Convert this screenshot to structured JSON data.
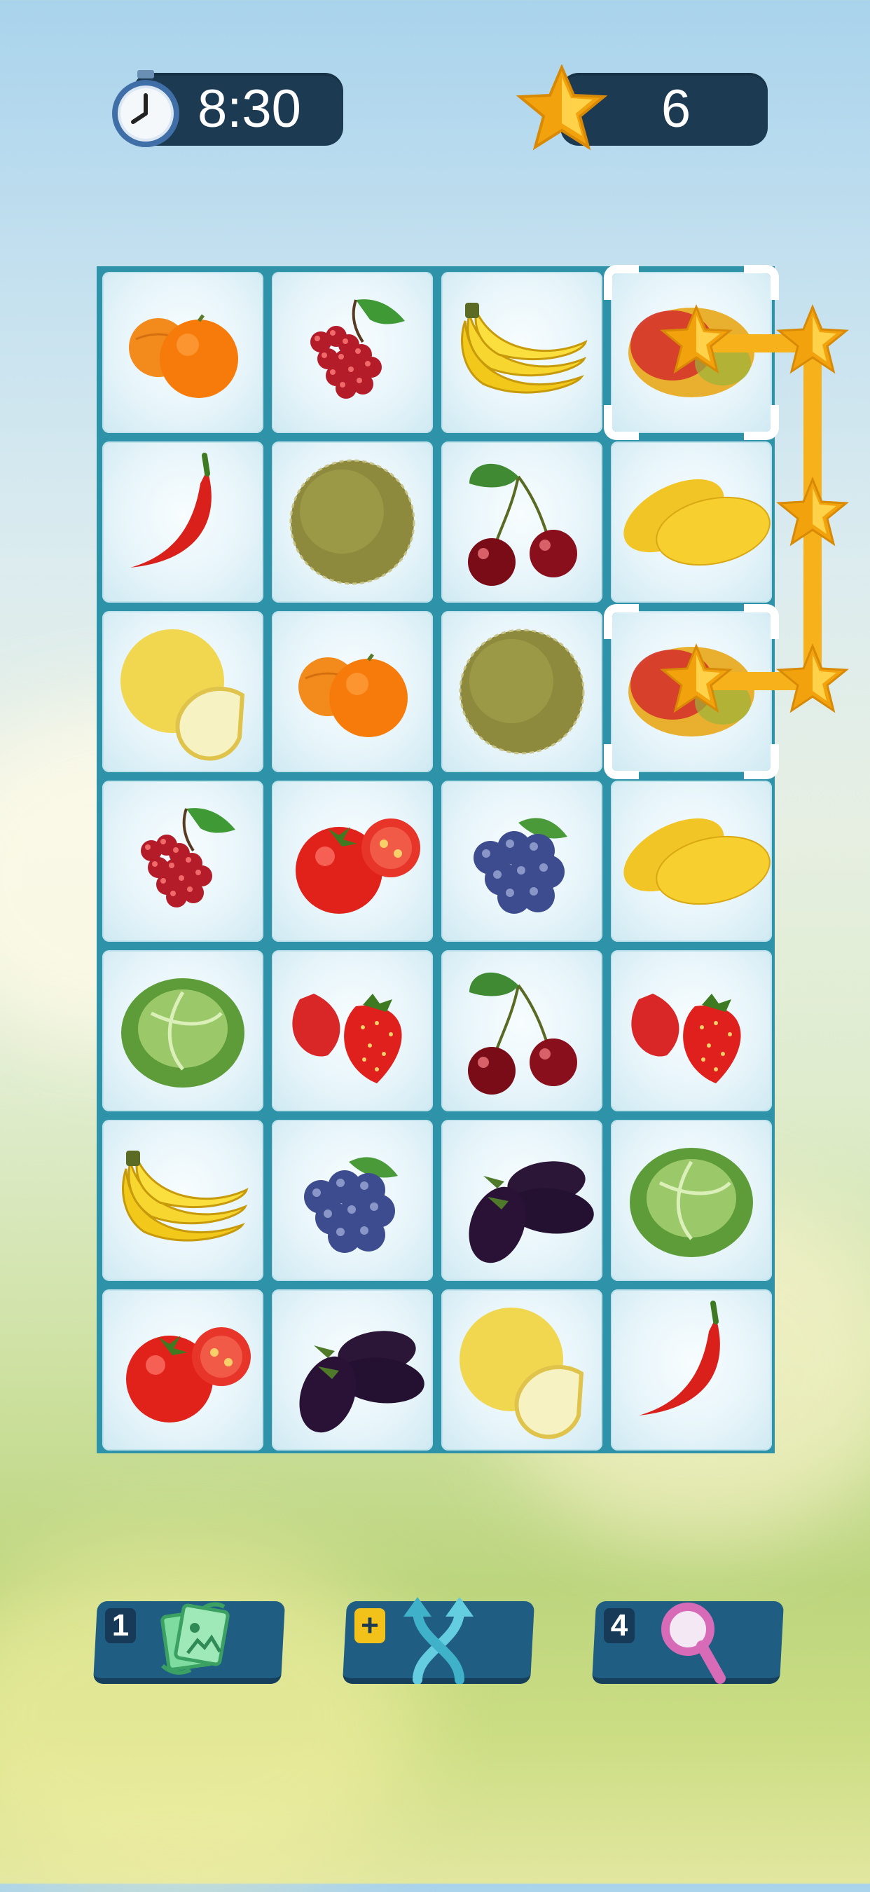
{
  "hud": {
    "timer": "8:30",
    "stars": "6",
    "timer_icon": "stopwatch-icon",
    "star_icon": "star-icon"
  },
  "board": {
    "rows": 7,
    "cols": 4,
    "tiles": [
      [
        "orange",
        "red-currant",
        "banana",
        "mango"
      ],
      [
        "chili-pepper",
        "cantaloupe",
        "cherry",
        "yellow-mango"
      ],
      [
        "honeydew-melon",
        "orange",
        "cantaloupe",
        "mango"
      ],
      [
        "red-currant",
        "tomato",
        "blueberry",
        "yellow-mango"
      ],
      [
        "cabbage",
        "strawberry",
        "cherry",
        "strawberry"
      ],
      [
        "banana",
        "blueberry",
        "eggplant",
        "cabbage"
      ],
      [
        "tomato",
        "eggplant",
        "honeydew-melon",
        "chili-pepper"
      ]
    ],
    "selected": [
      [
        0,
        3
      ],
      [
        2,
        3
      ]
    ],
    "hint_path": "star-path-icon"
  },
  "boosters": [
    {
      "count": "1",
      "icon": "shuffle-image-icon"
    },
    {
      "count": "+",
      "icon": "crossing-arrows-icon"
    },
    {
      "count": "4",
      "icon": "magnifier-icon"
    }
  ],
  "colors": {
    "accent": "#f7b21b",
    "pill": "#1c3a52",
    "board_border": "#2e93a8",
    "button": "#1f5e82"
  }
}
